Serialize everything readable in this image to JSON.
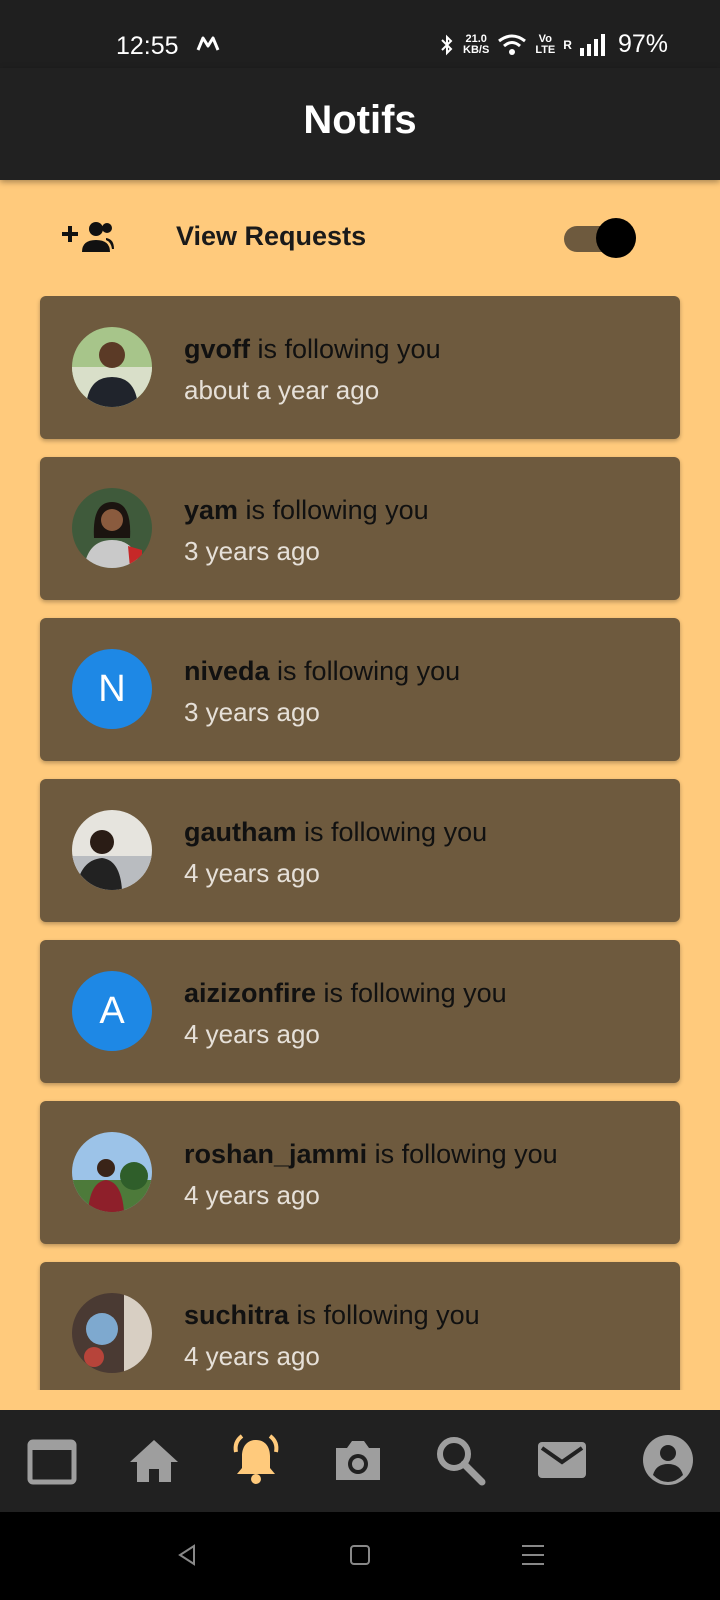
{
  "status_bar": {
    "time": "12:55",
    "net_speed_value": "21.0",
    "net_speed_unit": "KB/S",
    "volte_top": "Vo",
    "volte_bottom": "LTE",
    "roaming": "R",
    "battery": "97%"
  },
  "app_bar": {
    "title": "Notifs"
  },
  "requests": {
    "label": "View Requests",
    "icon": "group-add-icon",
    "toggle_on": true
  },
  "notifications": [
    {
      "username": "gvoff",
      "message": " is following you",
      "time": "about a year ago",
      "avatar_type": "photo",
      "avatar_letter": ""
    },
    {
      "username": "yam",
      "message": " is following you",
      "time": "3 years ago",
      "avatar_type": "photo",
      "avatar_letter": ""
    },
    {
      "username": "niveda",
      "message": " is following you",
      "time": "3 years ago",
      "avatar_type": "letter",
      "avatar_letter": "N"
    },
    {
      "username": "gautham",
      "message": " is following you",
      "time": "4 years ago",
      "avatar_type": "photo",
      "avatar_letter": ""
    },
    {
      "username": "aizizonfire",
      "message": " is following you",
      "time": "4 years ago",
      "avatar_type": "letter",
      "avatar_letter": "A"
    },
    {
      "username": "roshan_jammi",
      "message": " is following you",
      "time": "4 years ago",
      "avatar_type": "photo",
      "avatar_letter": ""
    },
    {
      "username": "suchitra",
      "message": " is following you",
      "time": "4 years ago",
      "avatar_type": "photo",
      "avatar_letter": ""
    }
  ],
  "bottom_nav": {
    "items": [
      {
        "name": "calendar",
        "icon": "calendar-icon",
        "active": false
      },
      {
        "name": "home",
        "icon": "home-icon",
        "active": false
      },
      {
        "name": "notifications",
        "icon": "bell-icon",
        "active": true
      },
      {
        "name": "camera",
        "icon": "camera-icon",
        "active": false
      },
      {
        "name": "search",
        "icon": "search-icon",
        "active": false
      },
      {
        "name": "messages",
        "icon": "mail-icon",
        "active": false
      },
      {
        "name": "profile",
        "icon": "account-icon",
        "active": false
      }
    ]
  },
  "colors": {
    "background": "#ffca7c",
    "card": "#6e5a3e",
    "app_bar": "#212121",
    "active_nav": "#ffca7c",
    "inactive_nav": "#9e9e9e",
    "letter_avatar": "#1e88e5"
  }
}
